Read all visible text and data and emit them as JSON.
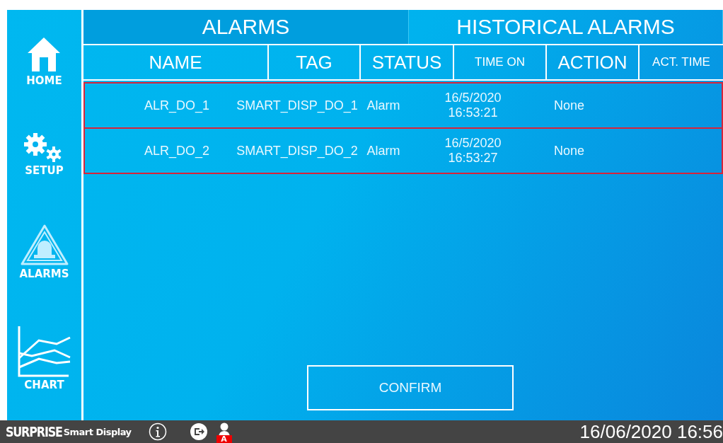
{
  "sidebar": {
    "items": [
      {
        "kind": "home",
        "label": "HOME"
      },
      {
        "kind": "setup",
        "label": "SETUP"
      },
      {
        "kind": "alarms",
        "label": "ALARMS"
      },
      {
        "kind": "chart",
        "label": "CHART"
      }
    ]
  },
  "tabs": [
    {
      "label": "ALARMS",
      "selected": true
    },
    {
      "label": "HISTORICAL ALARMS",
      "selected": false
    }
  ],
  "table": {
    "columns": [
      {
        "label": "NAME",
        "kind": "large"
      },
      {
        "label": "TAG",
        "kind": "large"
      },
      {
        "label": "STATUS",
        "kind": "large"
      },
      {
        "label": "TIME ON",
        "kind": "small"
      },
      {
        "label": "ACTION",
        "kind": "large"
      },
      {
        "label": "ACT. TIME",
        "kind": "small"
      }
    ],
    "rows": [
      {
        "name": "ALR_DO_1",
        "tag": "SMART_DISP_DO_1",
        "status": "Alarm",
        "time_on": [
          "16/5/2020",
          "16:53:21"
        ],
        "action": "None"
      },
      {
        "name": "ALR_DO_2",
        "tag": "SMART_DISP_DO_2",
        "status": "Alarm",
        "time_on": [
          "16/5/2020",
          "16:53:27"
        ],
        "action": "None"
      }
    ]
  },
  "confirm_button": "CONFIRM",
  "status_bar": {
    "brand": "SURPRISE",
    "product": "Smart Display",
    "user_badge": "A",
    "datetime": "16/06/2020 16:56"
  }
}
